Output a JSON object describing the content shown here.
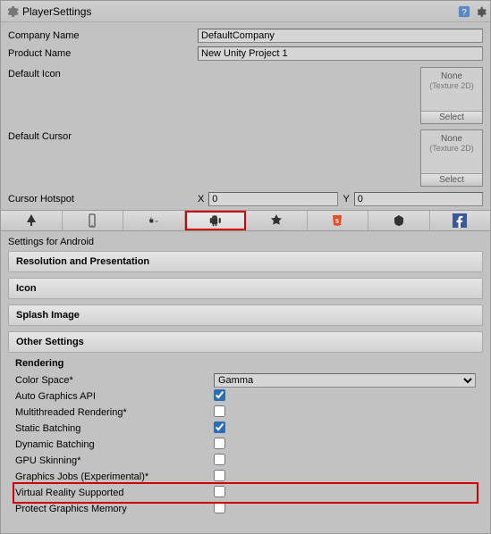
{
  "header": {
    "title": "PlayerSettings"
  },
  "fields": {
    "company_name_label": "Company Name",
    "company_name_value": "DefaultCompany",
    "product_name_label": "Product Name",
    "product_name_value": "New Unity Project 1",
    "default_icon_label": "Default Icon",
    "default_cursor_label": "Default Cursor",
    "texture_none": "None",
    "texture_type": "(Texture 2D)",
    "select_label": "Select",
    "cursor_hotspot_label": "Cursor Hotspot",
    "hotspot_x_label": "X",
    "hotspot_x_value": "0",
    "hotspot_y_label": "Y",
    "hotspot_y_value": "0"
  },
  "platform_subtitle": "Settings for Android",
  "sections": {
    "resolution": "Resolution and Presentation",
    "icon": "Icon",
    "splash": "Splash Image",
    "other": "Other Settings"
  },
  "other_settings": {
    "group_title": "Rendering",
    "color_space_label": "Color Space*",
    "color_space_value": "Gamma",
    "auto_graphics_label": "Auto Graphics API",
    "auto_graphics_checked": true,
    "multithreaded_label": "Multithreaded Rendering*",
    "multithreaded_checked": false,
    "static_batching_label": "Static Batching",
    "static_batching_checked": true,
    "dynamic_batching_label": "Dynamic Batching",
    "dynamic_batching_checked": false,
    "gpu_skinning_label": "GPU Skinning*",
    "gpu_skinning_checked": false,
    "graphics_jobs_label": "Graphics Jobs (Experimental)*",
    "graphics_jobs_checked": false,
    "vr_supported_label": "Virtual Reality Supported",
    "vr_supported_checked": false,
    "protect_memory_label": "Protect Graphics Memory",
    "protect_memory_checked": false
  }
}
